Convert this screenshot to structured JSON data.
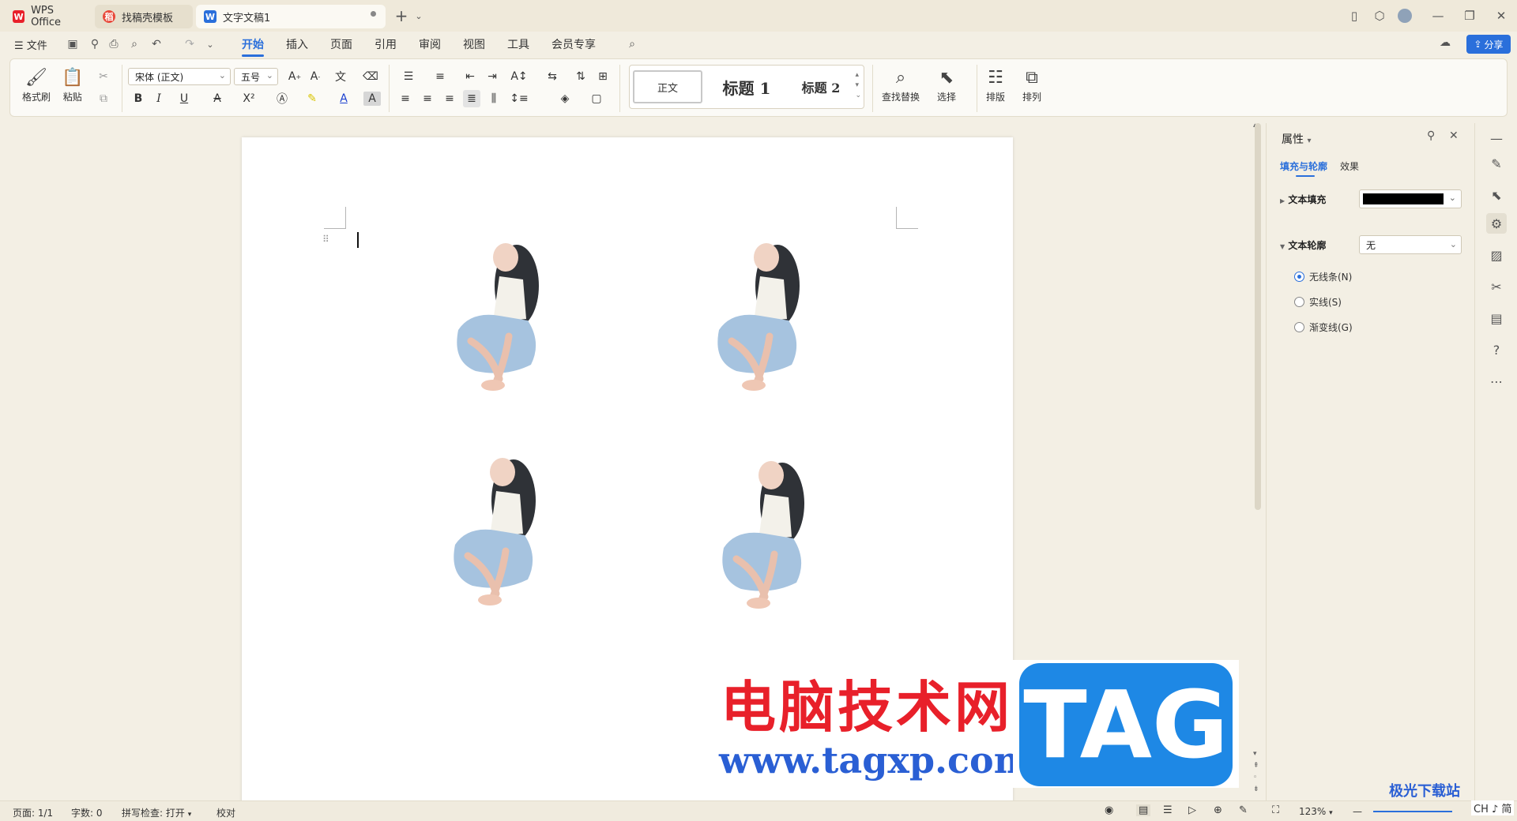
{
  "tabs": [
    {
      "label": "WPS Office",
      "logo": "W"
    },
    {
      "label": "找稿壳模板",
      "logo": "稻"
    },
    {
      "label": "文字文稿1",
      "logo": "W"
    }
  ],
  "menu": {
    "file": "文件",
    "items": [
      "开始",
      "插入",
      "页面",
      "引用",
      "审阅",
      "视图",
      "工具",
      "会员专享"
    ],
    "share": "分享"
  },
  "ribbon": {
    "format_painter": "格式刷",
    "paste": "粘贴",
    "font_name": "宋体 (正文)",
    "font_size": "五号",
    "styles": [
      "正文",
      "标题 1",
      "标题 2"
    ],
    "find_replace": "查找替换",
    "select": "选择",
    "layout": "排版",
    "arrange": "排列"
  },
  "panel": {
    "title": "属性",
    "tabs": [
      "填充与轮廓",
      "效果"
    ],
    "text_fill_label": "文本填充",
    "text_fill_color": "#000000",
    "text_outline_label": "文本轮廓",
    "text_outline_value": "无",
    "options": [
      "无线条(N)",
      "实线(S)",
      "渐变线(G)"
    ],
    "selected_option": 0
  },
  "status": {
    "page": "页面: 1/1",
    "words": "字数: 0",
    "spell": "拼写检查: 打开",
    "proof": "校对",
    "zoom": "123%"
  },
  "watermark": {
    "cn": "电脑技术网",
    "url": "www.tagxp.com",
    "tag": "TAG",
    "corner": "极光下载站",
    "corner2": "CH ♪ 简"
  },
  "colors": {
    "accent": "#2a6fdb",
    "wm_red": "#e8202a",
    "wm_blue": "#1e88e5"
  }
}
